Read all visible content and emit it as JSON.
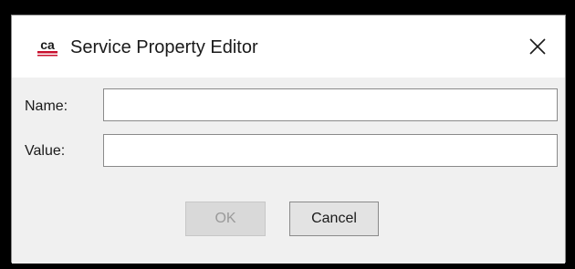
{
  "dialog": {
    "title": "Service Property Editor",
    "logo_icon": "ca-logo-icon",
    "logo_text": "ca",
    "close_icon": "close-icon"
  },
  "form": {
    "name_label": "Name:",
    "name_value": "",
    "value_label": "Value:",
    "value_value": ""
  },
  "buttons": {
    "ok_label": "OK",
    "ok_enabled": false,
    "cancel_label": "Cancel"
  },
  "colors": {
    "logo_red": "#c8102e",
    "background": "#f0f0f0",
    "titlebar": "#ffffff"
  }
}
